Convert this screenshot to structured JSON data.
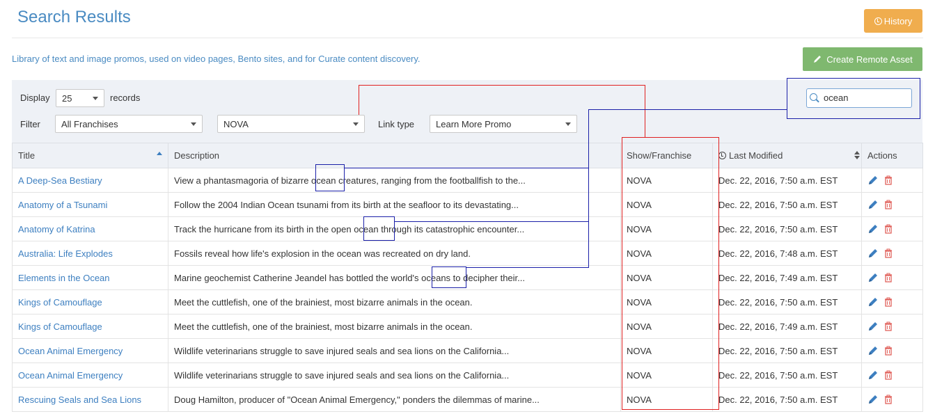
{
  "header": {
    "title": "Search Results",
    "history_label": "History"
  },
  "intro": {
    "text": "Library of text and image promos, used on video pages, Bento sites, and for Curate content discovery.",
    "create_label": "Create Remote Asset"
  },
  "filters": {
    "display_label": "Display",
    "display_value": "25",
    "records_label": "records",
    "filter_label": "Filter",
    "franchise_value": "All Franchises",
    "show_value": "NOVA",
    "link_type_label": "Link type",
    "link_type_value": "Learn More Promo",
    "search_value": "ocean"
  },
  "table": {
    "headers": {
      "title": "Title",
      "description": "Description",
      "show": "Show/Franchise",
      "modified": "Last Modified",
      "actions": "Actions"
    },
    "rows": [
      {
        "title": "A Deep-Sea Bestiary",
        "description": "View a phantasmagoria of bizarre ocean creatures, ranging from the footballfish to the...",
        "show": "NOVA",
        "modified": "Dec. 22, 2016, 7:50 a.m. EST"
      },
      {
        "title": "Anatomy of a Tsunami",
        "description": "Follow the 2004 Indian Ocean tsunami from its birth at the seafloor to its devastating...",
        "show": "NOVA",
        "modified": "Dec. 22, 2016, 7:50 a.m. EST"
      },
      {
        "title": "Anatomy of Katrina",
        "description": "Track the hurricane from its birth in the open ocean through its catastrophic encounter...",
        "show": "NOVA",
        "modified": "Dec. 22, 2016, 7:50 a.m. EST"
      },
      {
        "title": "Australia: Life Explodes",
        "description": "Fossils reveal how life's explosion in the ocean was recreated on dry land.",
        "show": "NOVA",
        "modified": "Dec. 22, 2016, 7:48 a.m. EST"
      },
      {
        "title": "Elements in the Ocean",
        "description": "Marine geochemist Catherine Jeandel has bottled the world's oceans to decipher their...",
        "show": "NOVA",
        "modified": "Dec. 22, 2016, 7:49 a.m. EST"
      },
      {
        "title": "Kings of Camouflage",
        "description": "Meet the cuttlefish, one of the brainiest, most bizarre animals in the ocean.",
        "show": "NOVA",
        "modified": "Dec. 22, 2016, 7:50 a.m. EST"
      },
      {
        "title": "Kings of Camouflage",
        "description": "Meet the cuttlefish, one of the brainiest, most bizarre animals in the ocean.",
        "show": "NOVA",
        "modified": "Dec. 22, 2016, 7:49 a.m. EST"
      },
      {
        "title": "Ocean Animal Emergency",
        "description": "Wildlife veterinarians struggle to save injured seals and sea lions on the California...",
        "show": "NOVA",
        "modified": "Dec. 22, 2016, 7:50 a.m. EST"
      },
      {
        "title": "Ocean Animal Emergency",
        "description": "Wildlife veterinarians struggle to save injured seals and sea lions on the California...",
        "show": "NOVA",
        "modified": "Dec. 22, 2016, 7:50 a.m. EST"
      },
      {
        "title": "Rescuing Seals and Sea Lions",
        "description": "Doug Hamilton, producer of \"Ocean Animal Emergency,\" ponders the dilemmas of marine...",
        "show": "NOVA",
        "modified": "Dec. 22, 2016, 7:50 a.m. EST"
      }
    ]
  },
  "colors": {
    "accent": "#4a8bc2",
    "history": "#f0ad4e",
    "create": "#7fb86f",
    "annotation_red": "#e02020",
    "annotation_blue": "#1a1fa8",
    "delete": "#e0605a"
  },
  "icons": {
    "history": "clock-icon",
    "create": "pencil-icon",
    "search": "magnifier-icon",
    "edit": "pencil-icon",
    "delete": "trash-icon"
  }
}
